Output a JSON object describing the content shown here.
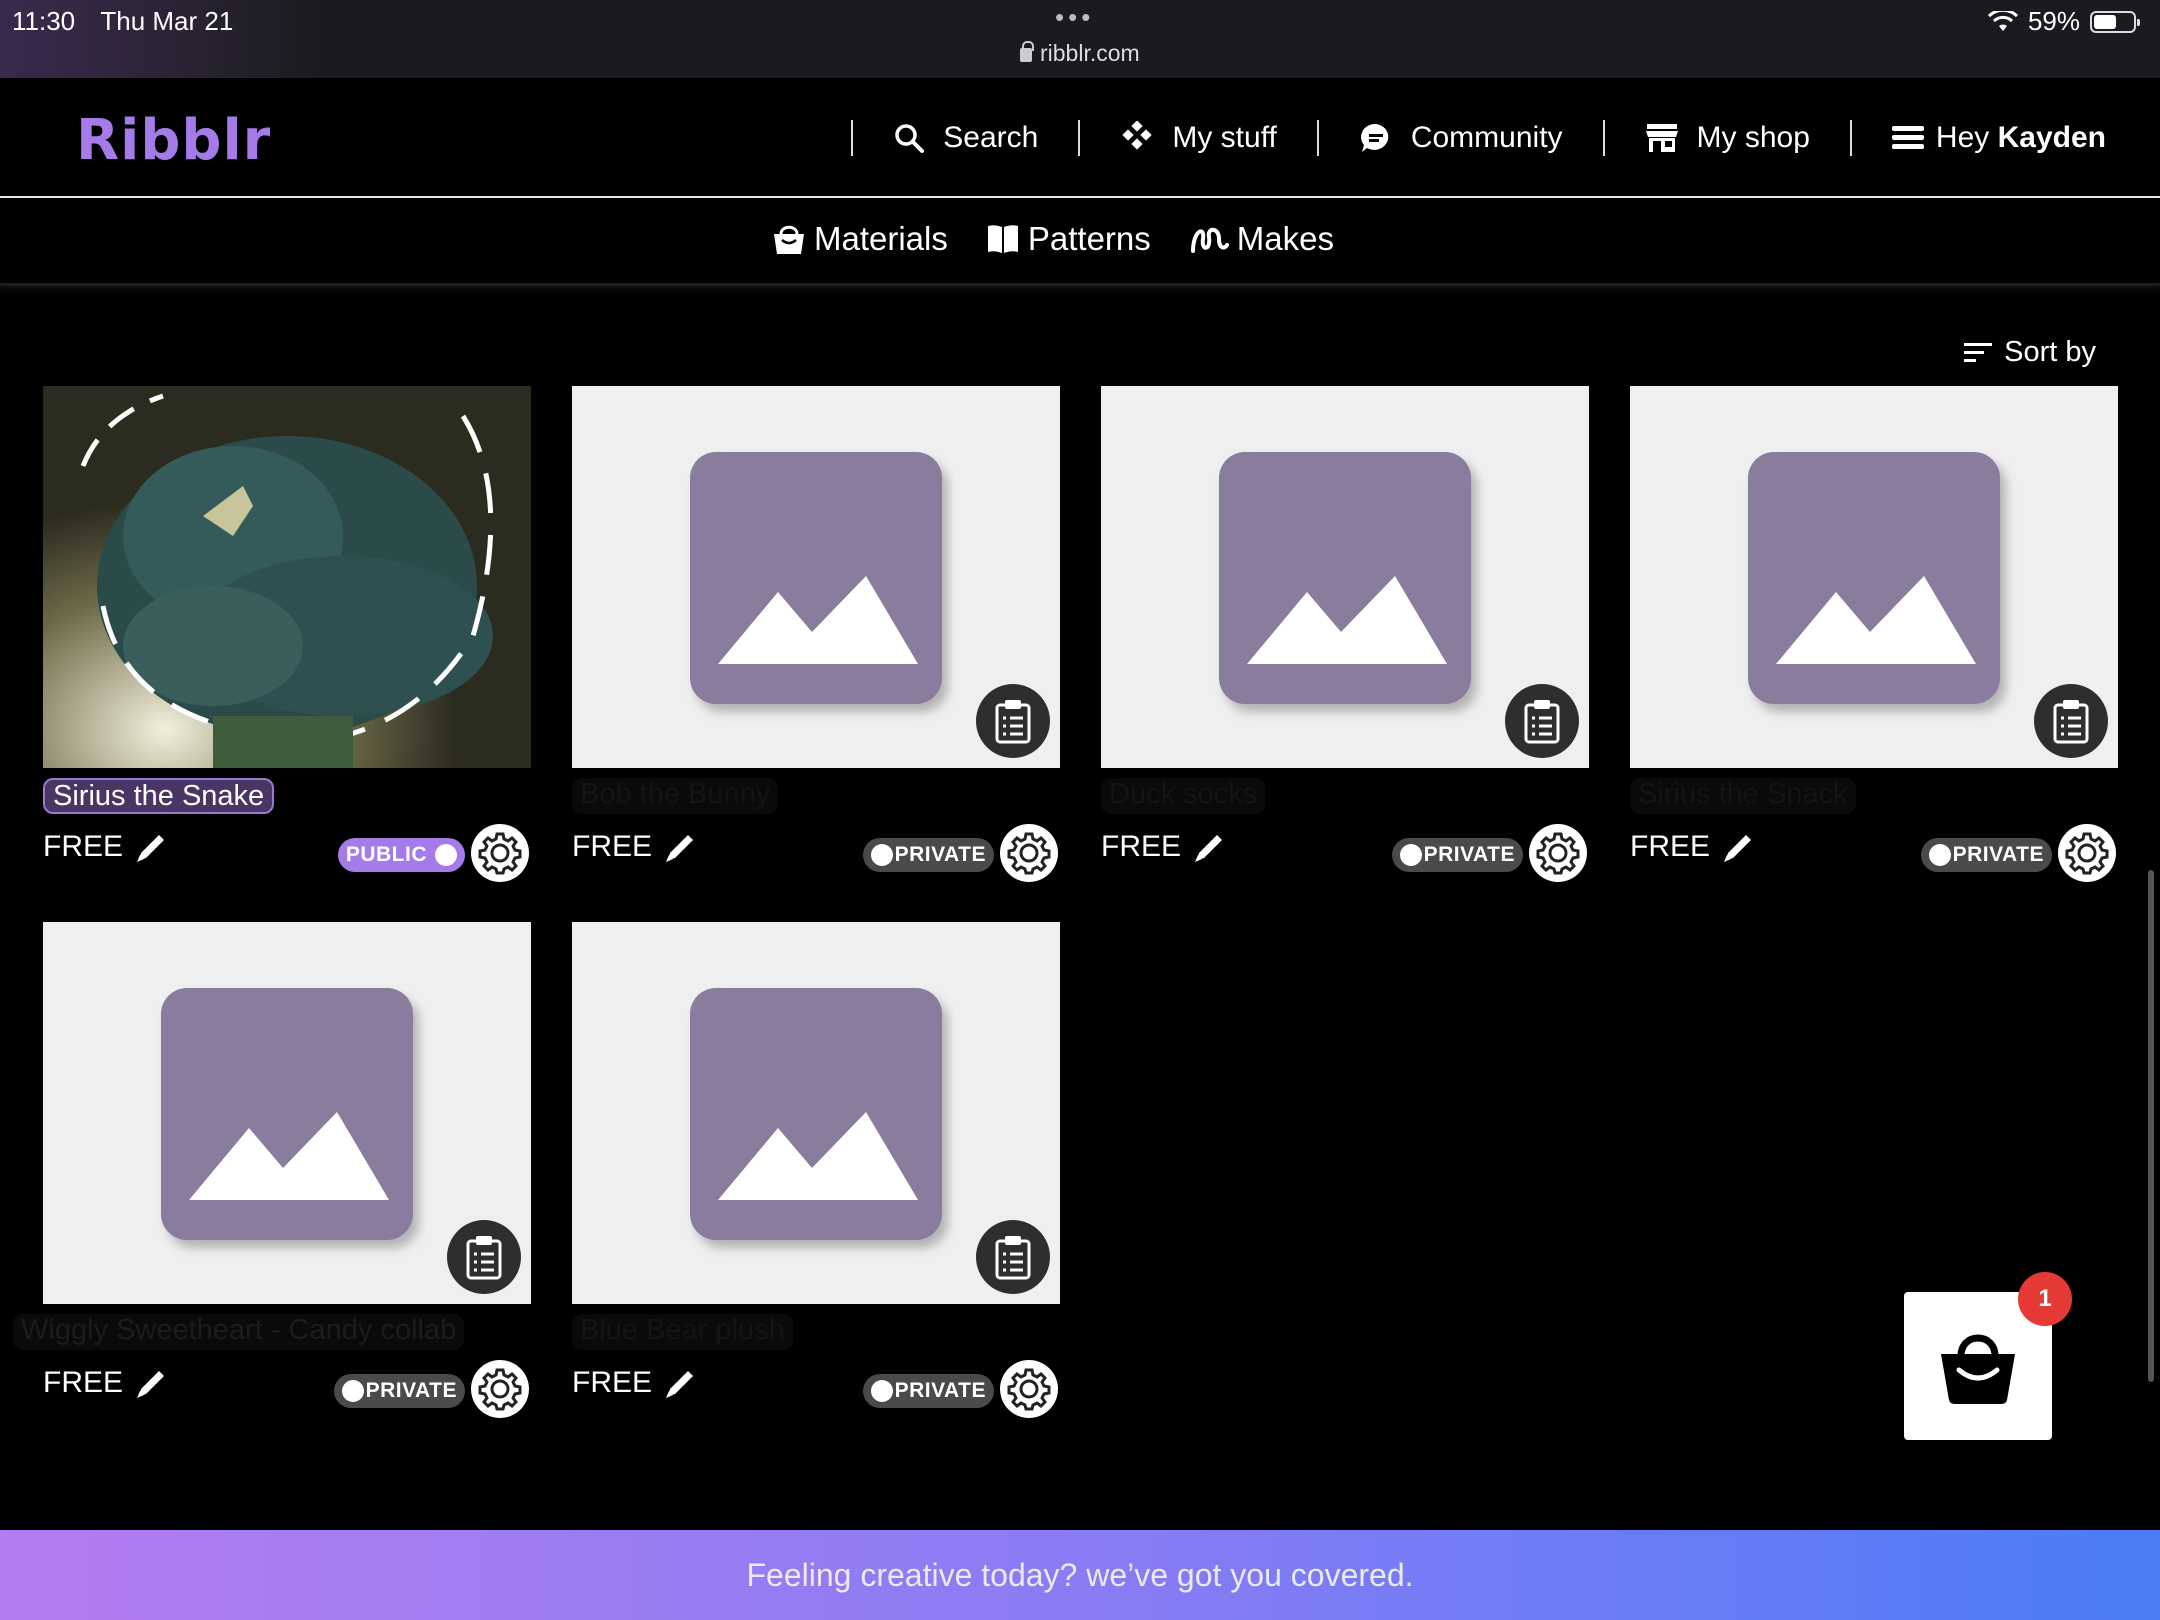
{
  "status_bar": {
    "time": "11:30",
    "date": "Thu Mar 21",
    "url": "ribblr.com",
    "battery": "59%",
    "battery_level": 0.59
  },
  "header": {
    "logo": "Ribblr",
    "nav": [
      {
        "label": "Search",
        "icon": "search-icon"
      },
      {
        "label": "My stuff",
        "icon": "diamond-grid-icon"
      },
      {
        "label": "Community",
        "icon": "chat-bubble-icon"
      },
      {
        "label": "My shop",
        "icon": "storefront-icon"
      }
    ],
    "greeting": "Hey",
    "user_name": "Kayden"
  },
  "subnav": [
    {
      "label": "Materials",
      "icon": "basket-icon"
    },
    {
      "label": "Patterns",
      "icon": "book-icon"
    },
    {
      "label": "Makes",
      "icon": "yarn-loop-icon"
    }
  ],
  "sort_label": "Sort by",
  "price_label": "FREE",
  "cards": [
    {
      "title": "Sirius the Snake",
      "status": "PUBLIC"
    },
    {
      "title": "Bob the Bunny",
      "status": "PRIVATE"
    },
    {
      "title": "Duck socks",
      "status": "PRIVATE"
    },
    {
      "title": "Sirius the Snack",
      "status": "PRIVATE"
    },
    {
      "title": "Wiggly Sweetheart - Candy collab",
      "status": "PRIVATE"
    },
    {
      "title": "Blue Bear plush",
      "status": "PRIVATE"
    }
  ],
  "cart": {
    "badge": "1"
  },
  "footer_text": "Feeling creative today? we’ve got you covered.",
  "colors": {
    "brand": "#a57be9",
    "placeholder": "#8a7c9c",
    "badge": "#e53935"
  }
}
